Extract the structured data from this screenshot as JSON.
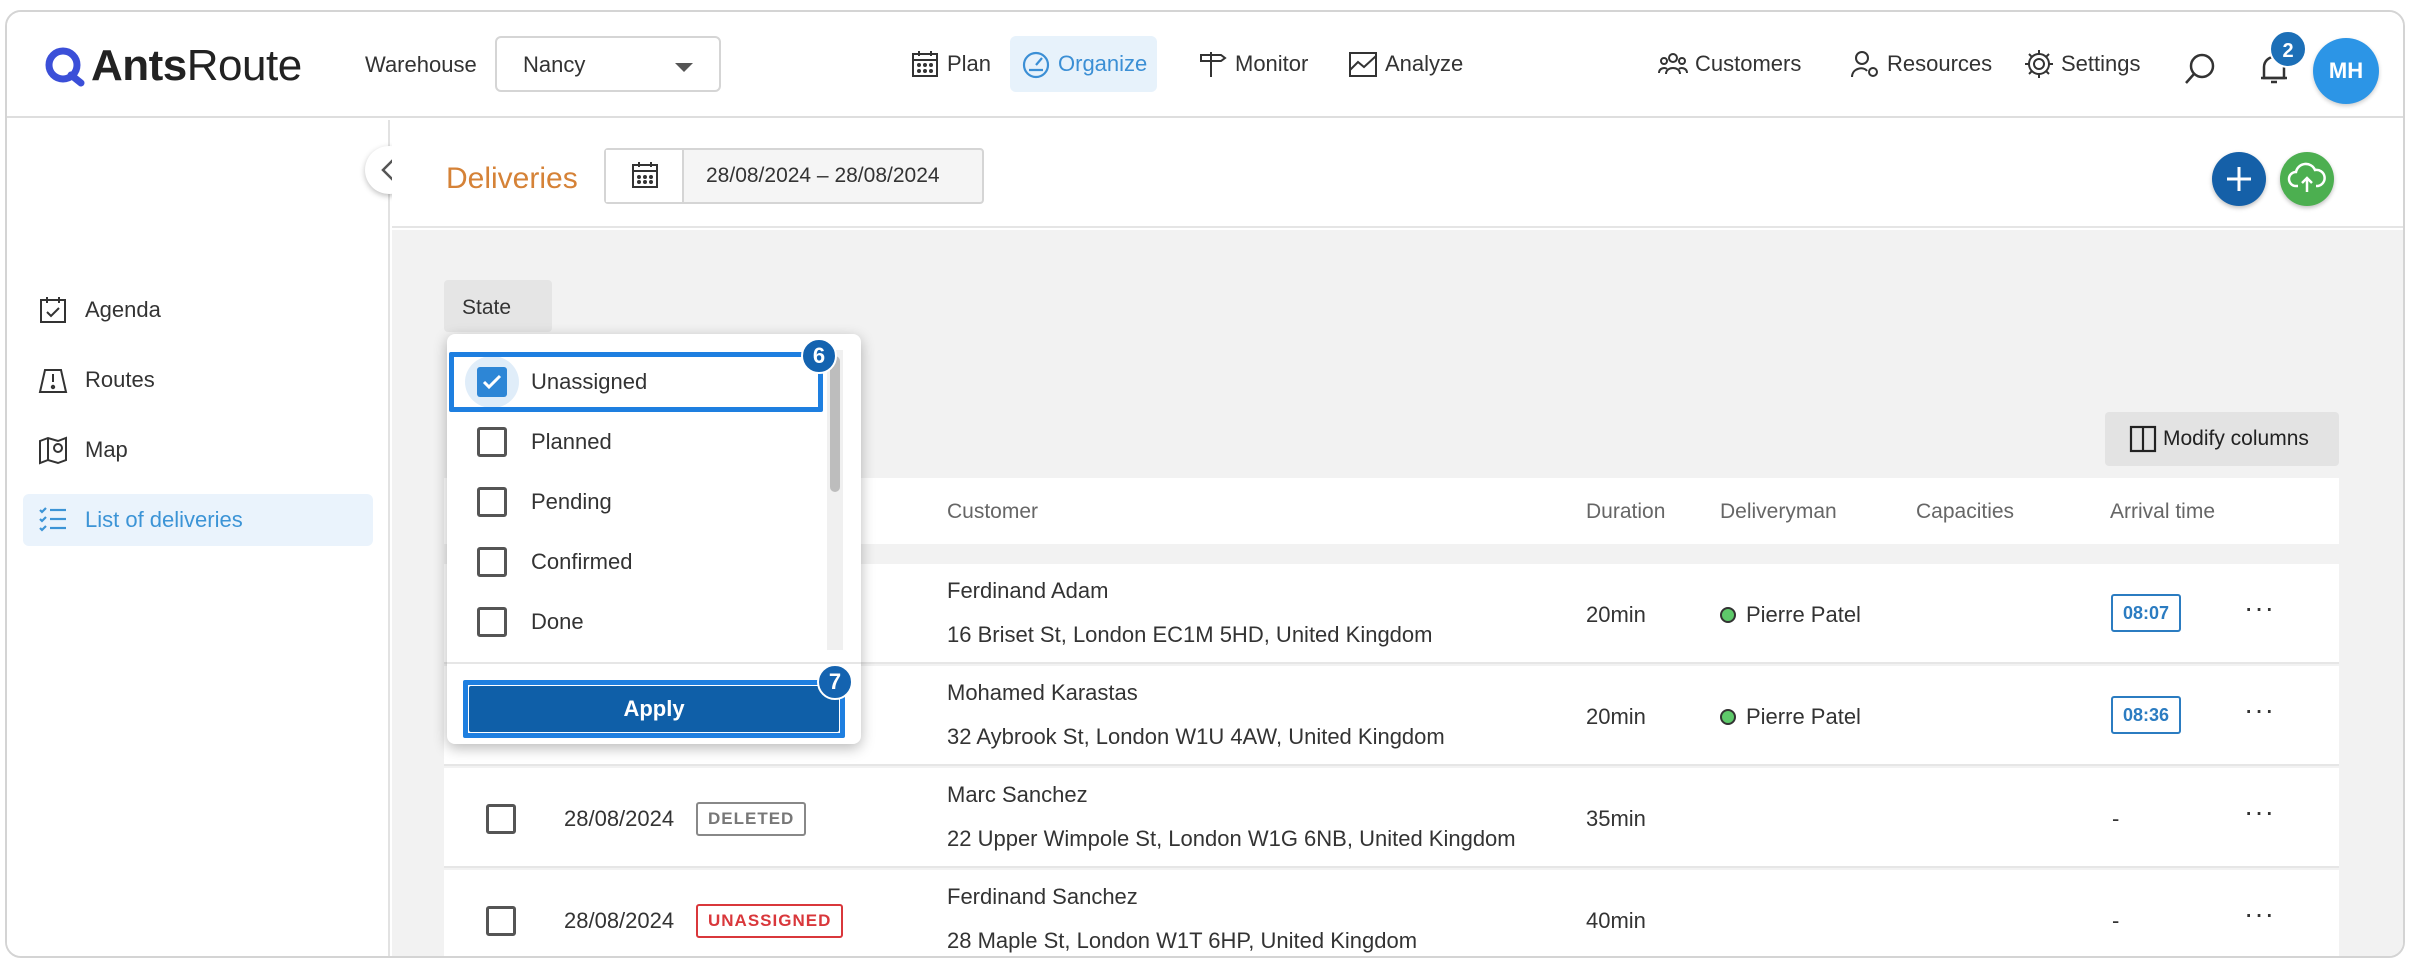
{
  "brand": {
    "name_bold": "Ants",
    "name_light": "Route"
  },
  "warehouse": {
    "label": "Warehouse",
    "value": "Nancy"
  },
  "nav": [
    {
      "label": "Plan",
      "icon": "calendar-grid-icon"
    },
    {
      "label": "Organize",
      "icon": "gauge-icon"
    },
    {
      "label": "Monitor",
      "icon": "signpost-icon"
    },
    {
      "label": "Analyze",
      "icon": "line-chart-icon"
    }
  ],
  "right_nav": [
    {
      "label": "Customers",
      "icon": "users-icon"
    },
    {
      "label": "Resources",
      "icon": "user-gear-icon"
    },
    {
      "label": "Settings",
      "icon": "gear-icon"
    }
  ],
  "notifications": {
    "count": "2"
  },
  "user": {
    "initials": "MH"
  },
  "sidebar": {
    "items": [
      {
        "label": "Agenda",
        "icon": "calendar-check-icon"
      },
      {
        "label": "Routes",
        "icon": "route-icon"
      },
      {
        "label": "Map",
        "icon": "map-icon"
      },
      {
        "label": "List of deliveries",
        "icon": "list-check-icon"
      }
    ]
  },
  "header": {
    "title": "Deliveries",
    "date_range": "28/08/2024 – 28/08/2024"
  },
  "filters": {
    "state_label": "State"
  },
  "toolbar": {
    "modify_columns": "Modify columns"
  },
  "table": {
    "columns": [
      "Customer",
      "Duration",
      "Deliveryman",
      "Capacities",
      "Arrival time"
    ],
    "rows": [
      {
        "date": "",
        "badge": "",
        "customer": "Ferdinand Adam",
        "address": "16 Briset St, London EC1M 5HD, United Kingdom",
        "duration": "20min",
        "deliveryman": "Pierre Patel",
        "arrival": "08:07"
      },
      {
        "date": "",
        "badge": "",
        "customer": "Mohamed Karastas",
        "address": "32 Aybrook St, London W1U 4AW, United Kingdom",
        "duration": "20min",
        "deliveryman": "Pierre Patel",
        "arrival": "08:36"
      },
      {
        "date": "28/08/2024",
        "badge": "DELETED",
        "customer": "Marc Sanchez",
        "address": "22 Upper Wimpole St, London W1G 6NB, United Kingdom",
        "duration": "35min",
        "deliveryman": "",
        "arrival": "-"
      },
      {
        "date": "28/08/2024",
        "badge": "UNASSIGNED",
        "customer": "Ferdinand Sanchez",
        "address": "28 Maple St, London W1T 6HP, United Kingdom",
        "duration": "40min",
        "deliveryman": "",
        "arrival": "-"
      }
    ],
    "more_label": "···"
  },
  "state_dropdown": {
    "options": [
      {
        "label": "Unassigned",
        "checked": true
      },
      {
        "label": "Planned",
        "checked": false
      },
      {
        "label": "Pending",
        "checked": false
      },
      {
        "label": "Confirmed",
        "checked": false
      },
      {
        "label": "Done",
        "checked": false
      }
    ],
    "apply_label": "Apply"
  },
  "steps": {
    "option_step": "6",
    "apply_step": "7"
  },
  "colors": {
    "accent": "#3b8fd5",
    "title": "#d58237",
    "primary": "#0f5fa8",
    "danger": "#d9373b",
    "success": "#4caf50"
  }
}
